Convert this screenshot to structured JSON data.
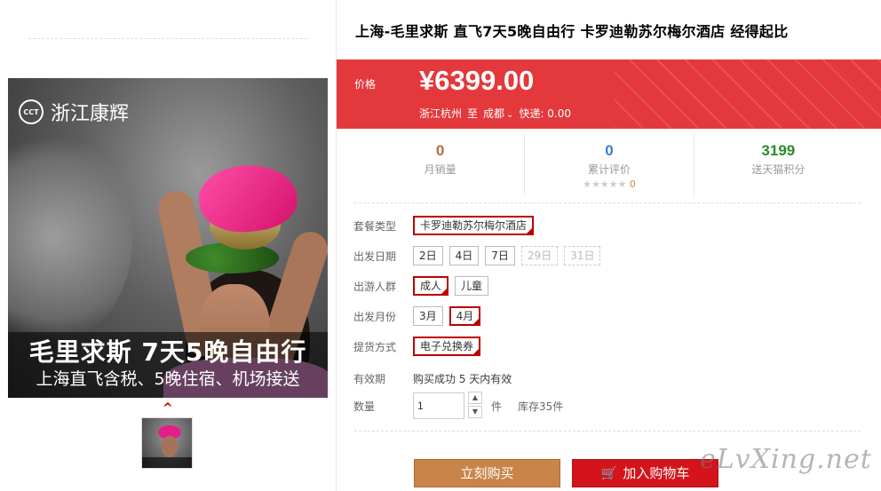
{
  "hero": {
    "logo_text": "浙江康辉",
    "logo_badge": "CCT",
    "caption_line1": "毛里求斯 7天5晚自由行",
    "caption_line2": "上海直飞含税、5晚住宿、机场接送"
  },
  "product": {
    "title": "上海-毛里求斯 直飞7天5晚自由行 卡罗迪勒苏尔梅尔酒店 经得起比"
  },
  "price": {
    "label": "价格",
    "value": "¥6399.00",
    "from_city": "浙江杭州",
    "to_word": "至",
    "dest_city": "成都",
    "shipping": "快递: 0.00"
  },
  "stats": [
    {
      "value": "0",
      "label": "月销量"
    },
    {
      "value": "0",
      "label": "累计评价",
      "stars": "★★★★★",
      "star_count": "0"
    },
    {
      "value": "3199",
      "label": "送天猫积分"
    }
  ],
  "options": {
    "package": {
      "label": "套餐类型",
      "values": [
        "卡罗迪勒苏尔梅尔酒店"
      ]
    },
    "date": {
      "label": "出发日期",
      "values": [
        "2日",
        "4日",
        "7日",
        "29日",
        "31日"
      ]
    },
    "group": {
      "label": "出游人群",
      "values": [
        "成人",
        "儿童"
      ]
    },
    "month": {
      "label": "出发月份",
      "values": [
        "3月",
        "4月"
      ]
    },
    "delivery": {
      "label": "提货方式",
      "values": [
        "电子兑换券"
      ]
    }
  },
  "validity": {
    "label": "有效期",
    "text": "购买成功 5 天内有效"
  },
  "quantity": {
    "label": "数量",
    "value": "1",
    "unit": "件",
    "stock": "库存35件"
  },
  "buttons": {
    "buy": "立刻购买",
    "cart": "加入购物车"
  },
  "watermark": "eLvXing.net",
  "colors": {
    "price_bar": "#e4393c",
    "buy": "#c9844a",
    "cart": "#d4141b"
  }
}
